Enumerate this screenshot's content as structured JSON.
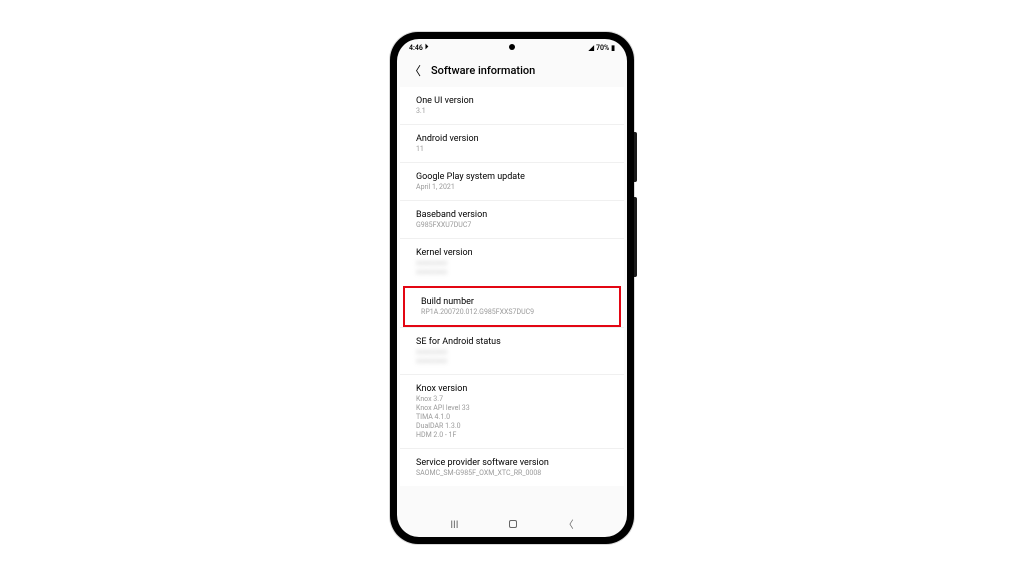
{
  "status": {
    "time": "4:46",
    "battery_pct": "70%"
  },
  "header": {
    "title": "Software information"
  },
  "items": [
    {
      "title": "One UI version",
      "value": "3.1"
    },
    {
      "title": "Android version",
      "value": "11"
    },
    {
      "title": "Google Play system update",
      "value": "April 1, 2021"
    },
    {
      "title": "Baseband version",
      "value": "G985FXXU7DUC7"
    },
    {
      "title": "Kernel version",
      "value": ""
    },
    {
      "title": "Build number",
      "value": "RP1A.200720.012.G985FXXS7DUC9",
      "highlight": true
    },
    {
      "title": "SE for Android status",
      "value": ""
    },
    {
      "title": "Knox version",
      "value": "Knox 3.7\nKnox API level 33\nTIMA 4.1.0\nDualDAR 1.3.0\nHDM 2.0 - 1F"
    },
    {
      "title": "Service provider software version",
      "value": "SAOMC_SM-G985F_OXM_XTC_RR_0008"
    }
  ]
}
